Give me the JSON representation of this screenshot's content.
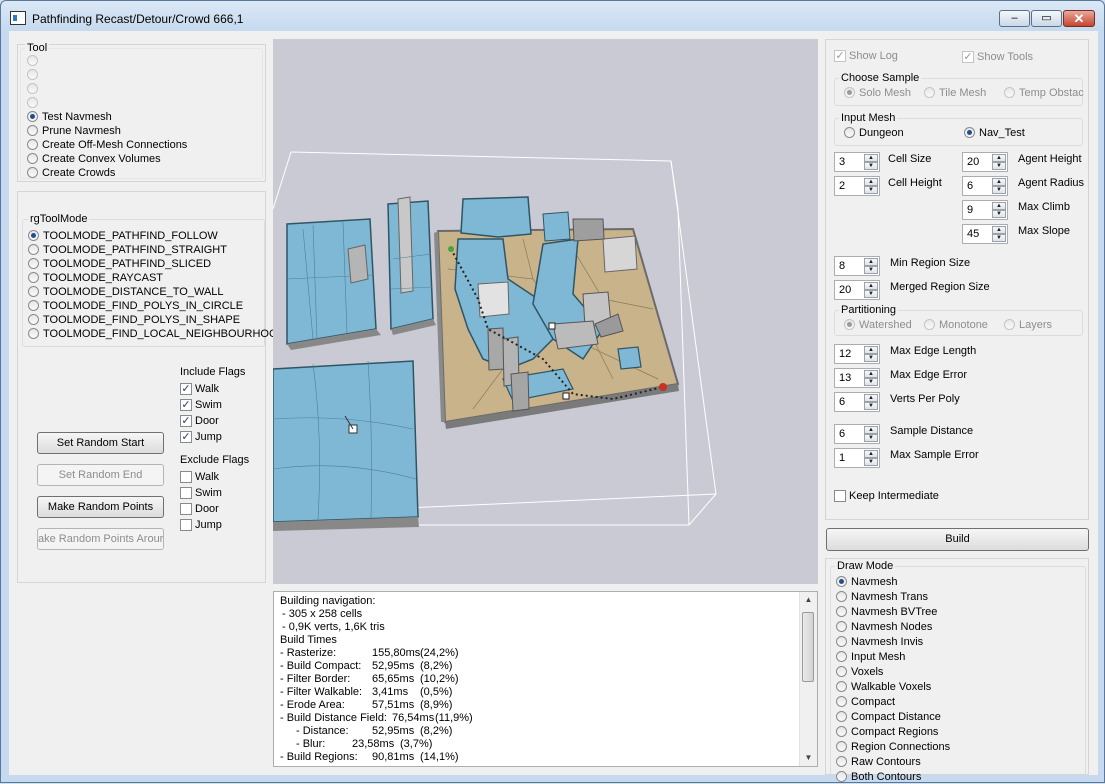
{
  "window": {
    "title": "Pathfinding Recast/Detour/Crowd 666,1",
    "minimize_glyph": "–",
    "maximize_glyph": "▭",
    "close_glyph": "✕"
  },
  "tool": {
    "title": "Tool",
    "items": [
      {
        "label": "",
        "selected": false
      },
      {
        "label": "",
        "selected": false
      },
      {
        "label": "",
        "selected": false
      },
      {
        "label": "",
        "selected": false
      },
      {
        "label": "Test Navmesh",
        "selected": true
      },
      {
        "label": "Prune Navmesh",
        "selected": false
      },
      {
        "label": "Create Off-Mesh Connections",
        "selected": false
      },
      {
        "label": "Create Convex Volumes",
        "selected": false
      },
      {
        "label": "Create Crowds",
        "selected": false
      }
    ]
  },
  "tool_mode": {
    "title": "rgToolMode",
    "items": [
      {
        "label": "TOOLMODE_PATHFIND_FOLLOW",
        "selected": true
      },
      {
        "label": "TOOLMODE_PATHFIND_STRAIGHT",
        "selected": false
      },
      {
        "label": "TOOLMODE_PATHFIND_SLICED",
        "selected": false
      },
      {
        "label": "TOOLMODE_RAYCAST",
        "selected": false
      },
      {
        "label": "TOOLMODE_DISTANCE_TO_WALL",
        "selected": false
      },
      {
        "label": "TOOLMODE_FIND_POLYS_IN_CIRCLE",
        "selected": false
      },
      {
        "label": "TOOLMODE_FIND_POLYS_IN_SHAPE",
        "selected": false
      },
      {
        "label": "TOOLMODE_FIND_LOCAL_NEIGHBOURHOOD",
        "selected": false
      }
    ]
  },
  "test_buttons": {
    "set_random_start": "Set Random Start",
    "set_random_end": "Set Random End",
    "make_random_points": "Make Random Points",
    "make_random_points_around": "ake Random Points Arour"
  },
  "include_flags": {
    "title": "Include Flags",
    "items": [
      {
        "label": "Walk",
        "checked": true
      },
      {
        "label": "Swim",
        "checked": true
      },
      {
        "label": "Door",
        "checked": true
      },
      {
        "label": "Jump",
        "checked": true
      }
    ]
  },
  "exclude_flags": {
    "title": "Exclude Flags",
    "items": [
      {
        "label": "Walk",
        "checked": false
      },
      {
        "label": "Swim",
        "checked": false
      },
      {
        "label": "Door",
        "checked": false
      },
      {
        "label": "Jump",
        "checked": false
      }
    ]
  },
  "right": {
    "show_log": "Show Log",
    "show_tools": "Show Tools",
    "choose_sample": {
      "title": "Choose Sample",
      "options": [
        "Solo Mesh",
        "Tile Mesh",
        "Temp Obstac"
      ],
      "selected_index": 0
    },
    "input_mesh": {
      "title": "Input Mesh",
      "options": [
        "Dungeon",
        "Nav_Test"
      ],
      "selected_index": 1
    },
    "params_left": [
      {
        "value": "3",
        "label": "Cell Size"
      },
      {
        "value": "2",
        "label": "Cell Height"
      }
    ],
    "params_agent": [
      {
        "value": "20",
        "label": "Agent Height"
      },
      {
        "value": "6",
        "label": "Agent Radius"
      },
      {
        "value": "9",
        "label": "Max Climb"
      },
      {
        "value": "45",
        "label": "Max Slope"
      }
    ],
    "region": [
      {
        "value": "8",
        "label": "Min Region Size"
      },
      {
        "value": "20",
        "label": "Merged Region Size"
      }
    ],
    "partitioning": {
      "title": "Partitioning",
      "options": [
        "Watershed",
        "Monotone",
        "Layers"
      ],
      "selected_index": 0
    },
    "edge_params": [
      {
        "value": "12",
        "label": "Max Edge Length"
      },
      {
        "value": "13",
        "label": "Max Edge Error"
      },
      {
        "value": "6",
        "label": "Verts Per Poly"
      }
    ],
    "sample_params": [
      {
        "value": "6",
        "label": "Sample Distance"
      },
      {
        "value": "1",
        "label": "Max Sample Error"
      }
    ],
    "keep_intermediate": "Keep Intermediate",
    "build": "Build",
    "draw_mode": {
      "title": "Draw Mode",
      "options": [
        "Navmesh",
        "Navmesh Trans",
        "Navmesh BVTree",
        "Navmesh Nodes",
        "Navmesh Invis",
        "Input Mesh",
        "Voxels",
        "Walkable Voxels",
        "Compact",
        "Compact Distance",
        "Compact Regions",
        "Region Connections",
        "Raw Contours",
        "Both Contours"
      ],
      "selected_index": 0
    }
  },
  "log": {
    "lines": [
      {
        "text": "Building navigation:",
        "indent": 0
      },
      {
        "text": "- 305 x 258 cells",
        "indent": 1
      },
      {
        "text": "- 0,9K verts, 1,6K tris",
        "indent": 1
      },
      {
        "text": "Build Times",
        "indent": 0
      },
      {
        "text": "- Rasterize:",
        "ms": "155,80ms",
        "pct": "(24,2%)",
        "indent": 0
      },
      {
        "text": "- Build Compact:",
        "ms": "52,95ms",
        "pct": "(8,2%)",
        "indent": 0
      },
      {
        "text": "- Filter Border:",
        "ms": "65,65ms",
        "pct": "(10,2%)",
        "indent": 0
      },
      {
        "text": "- Filter Walkable:",
        "ms": "3,41ms",
        "pct": "(0,5%)",
        "indent": 0
      },
      {
        "text": "- Erode Area:",
        "ms": "57,51ms",
        "pct": "(8,9%)",
        "indent": 0
      },
      {
        "text": "- Build Distance Field:",
        "ms": "76,54ms",
        "pct": "(11,9%)",
        "indent": 0
      },
      {
        "text": "- Distance:",
        "ms": "52,95ms",
        "pct": "(8,2%)",
        "indent": 2
      },
      {
        "text": "- Blur:",
        "ms": "23,58ms",
        "pct": "(3,7%)",
        "indent": 2
      },
      {
        "text": "- Build Regions:",
        "ms": "90,81ms",
        "pct": "(14,1%)",
        "indent": 0
      }
    ]
  },
  "colors": {
    "viewport_bg": "#cacad5",
    "navmesh_blue": "#7fb8d4",
    "navmesh_edge": "#2e5566",
    "floor_tan": "#c9b38a",
    "wall_grey": "#9a9a9a"
  }
}
